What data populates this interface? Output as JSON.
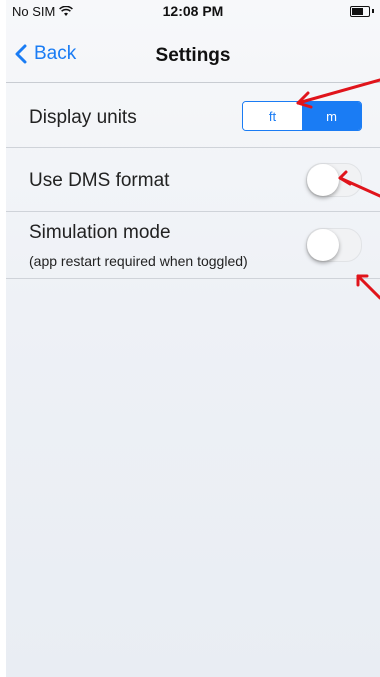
{
  "status": {
    "carrier": "No SIM",
    "time": "12:08 PM"
  },
  "nav": {
    "back": "Back",
    "title": "Settings"
  },
  "rows": {
    "units": {
      "label": "Display units",
      "options": [
        "ft",
        "m"
      ],
      "selected": "m"
    },
    "dms": {
      "label": "Use DMS format",
      "on": false
    },
    "sim": {
      "label": "Simulation mode",
      "sublabel": "(app restart required when toggled)",
      "on": false
    }
  },
  "colors": {
    "accent": "#1a7cf4",
    "annotation": "#e0141b"
  }
}
